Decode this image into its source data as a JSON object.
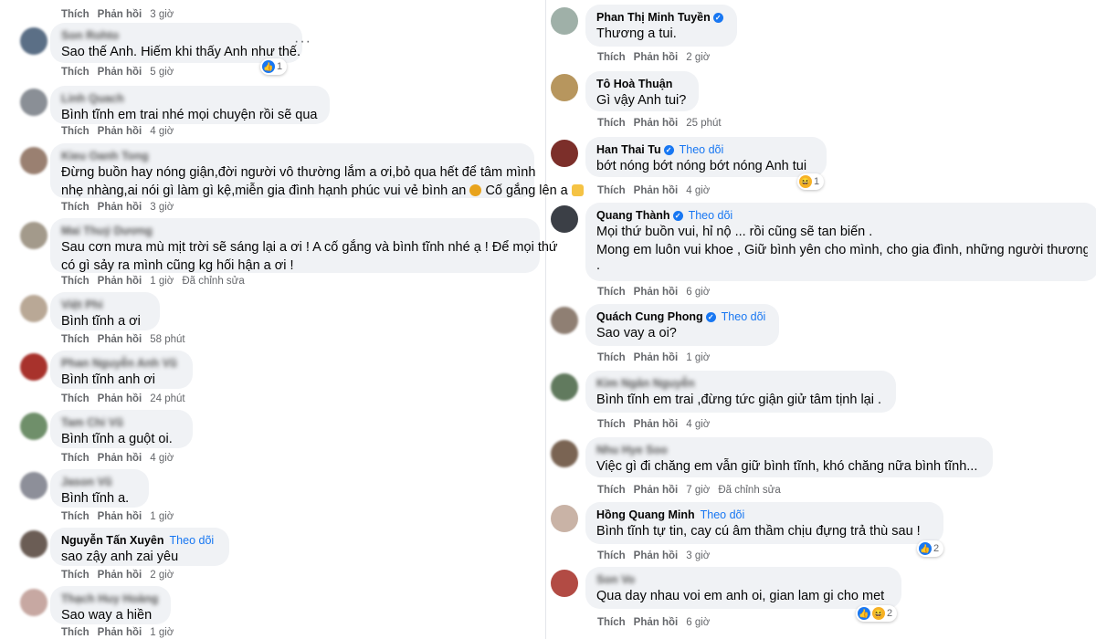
{
  "left": {
    "top_meta": {
      "like": "Thích",
      "reply": "Phản hồi",
      "time": "3 giờ"
    },
    "comments": [
      {
        "name": "Son Rohto",
        "text": "Sao thế Anh. Hiếm khi thấy Anh như thế.",
        "like": "Thích",
        "reply": "Phản hồi",
        "time": "5 giờ",
        "reaction": "1"
      },
      {
        "name": "Linh Quach",
        "text": "Bình tĩnh em trai nhé mọi chuyện rồi sẽ qua",
        "like": "Thích",
        "reply": "Phản hồi",
        "time": "4 giờ"
      },
      {
        "name": "Kieu Oanh Tong",
        "text": "Đừng buồn hay nóng giận,đời người vô thường lắm a ơi,bỏ qua hết để tâm mình",
        "text2": "nhẹ nhàng,ai nói gì làm gì kệ,miễn gia đình hạnh phúc vui vẻ bình an",
        "text2_tail": "Cố gắng lên a",
        "like": "Thích",
        "reply": "Phản hồi",
        "time": "3 giờ"
      },
      {
        "name": "Mai Thuý Dương",
        "text": "Sau cơn mưa mù mịt trời sẽ sáng lại a ơi ! A cố gắng và bình tĩnh nhé ạ ! Để mọi thứ",
        "text2": "có gì sảy ra mình cũng kg hối hận a ơi !",
        "like": "Thích",
        "reply": "Phản hồi",
        "time": "1 giờ",
        "edited": "Đã chỉnh sửa"
      },
      {
        "name": "Việt Phi",
        "text": "Bình tĩnh a ơi",
        "like": "Thích",
        "reply": "Phản hồi",
        "time": "58 phút"
      },
      {
        "name": "Phan Nguyễn Anh Vũ",
        "text": "Bình tĩnh anh ơi",
        "like": "Thích",
        "reply": "Phản hồi",
        "time": "24 phút"
      },
      {
        "name": "Tam Chi Vũ",
        "text": "Bình tĩnh a guột oi.",
        "like": "Thích",
        "reply": "Phản hồi",
        "time": "4 giờ"
      },
      {
        "name": "Jason Vũ",
        "text": "Bình tĩnh a.",
        "like": "Thích",
        "reply": "Phản hồi",
        "time": "1 giờ"
      },
      {
        "name": "Nguyễn Tấn Xuyên",
        "follow": "Theo dõi",
        "text": "sao zậy anh zai yêu",
        "like": "Thích",
        "reply": "Phản hồi",
        "time": "2 giờ"
      },
      {
        "name": "Thạch Huy Hoàng",
        "text": "Sao way a hiền",
        "like": "Thích",
        "reply": "Phản hồi",
        "time": "1 giờ"
      }
    ]
  },
  "right": {
    "comments": [
      {
        "name": "Phan Thị Minh Tuyền",
        "verified": true,
        "text": "Thương a tui.",
        "like": "Thích",
        "reply": "Phản hồi",
        "time": "2 giờ"
      },
      {
        "name": "Tô Hoà Thuận",
        "text": "Gì vậy Anh tui?",
        "like": "Thích",
        "reply": "Phản hồi",
        "time": "25 phút"
      },
      {
        "name": "Han Thai Tu",
        "verified": true,
        "follow": "Theo dõi",
        "text": "bớt nóng bớt nóng bớt nóng Anh tui",
        "like": "Thích",
        "reply": "Phản hồi",
        "time": "4 giờ",
        "reaction": "1"
      },
      {
        "name": "Quang Thành",
        "verified": true,
        "follow": "Theo dõi",
        "text": "Mọi thứ buồn vui, hỉ nộ ... rồi cũng sẽ tan biến .",
        "text2": "Mong em luôn vui khoe , Giữ bình yên cho mình, cho gia đình, những người thương",
        "text3": ".",
        "like": "Thích",
        "reply": "Phản hồi",
        "time": "6 giờ"
      },
      {
        "name": "Quách Cung Phong",
        "verified": true,
        "follow": "Theo dõi",
        "text": "Sao vay a oi?",
        "like": "Thích",
        "reply": "Phản hồi",
        "time": "1 giờ"
      },
      {
        "name": "Kim Ngân Nguyễn",
        "text": "Bình tĩnh em trai ,đừng tức giận giử tâm tịnh lại .",
        "like": "Thích",
        "reply": "Phản hồi",
        "time": "4 giờ"
      },
      {
        "name": "Nhu Hye Soo",
        "text": "Việc gì đi chăng em vẫn giữ bình tĩnh, khó chăng nữa bình tĩnh...",
        "like": "Thích",
        "reply": "Phản hồi",
        "time": "7 giờ",
        "edited": "Đã chỉnh sửa"
      },
      {
        "name": "Hồng Quang Minh",
        "follow": "Theo dõi",
        "text": "Bình tĩnh tự tin, cay cú âm thầm chịu đựng trả thù sau !",
        "like": "Thích",
        "reply": "Phản hồi",
        "time": "3 giờ",
        "reaction": "2"
      },
      {
        "name": "Son Vo",
        "text": "Qua day nhau voi em anh oi, gian lam gi cho met",
        "like": "Thích",
        "reply": "Phản hồi",
        "time": "6 giờ",
        "reaction": "2"
      }
    ]
  }
}
